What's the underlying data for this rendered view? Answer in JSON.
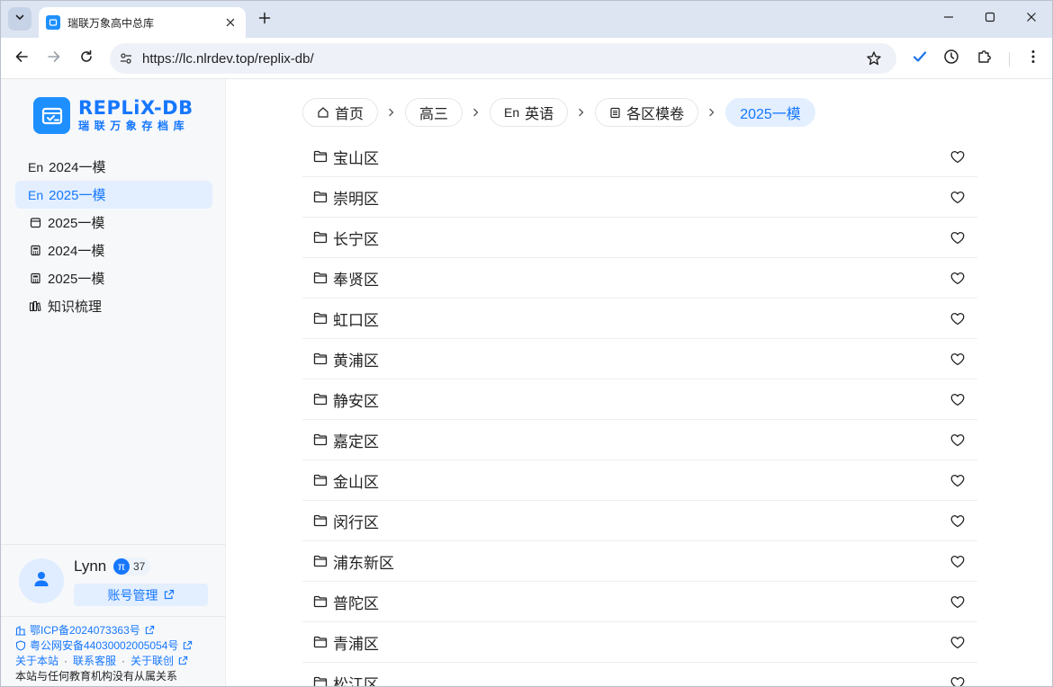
{
  "browser": {
    "tab_title": "瑞联万象高中总库",
    "url": "https://lc.nlrdev.top/replix-db/"
  },
  "logo": {
    "title": "REPLiX-DB",
    "subtitle": "瑞联万象存档库"
  },
  "sidebar": {
    "items": [
      {
        "icon": "En",
        "label": "2024一模",
        "active": false
      },
      {
        "icon": "En",
        "label": "2025一模",
        "active": true
      },
      {
        "icon": "calendar-icon",
        "label": "2025一模",
        "active": false
      },
      {
        "icon": "calculator-icon",
        "label": "2024一模",
        "active": false
      },
      {
        "icon": "calculator-icon",
        "label": "2025一模",
        "active": false
      },
      {
        "icon": "books-icon",
        "label": "知识梳理",
        "active": false
      }
    ]
  },
  "user": {
    "name": "Lynn",
    "badge_symbol": "π",
    "points": "37",
    "account_label": "账号管理"
  },
  "footer": {
    "icp": "鄂ICP备2024073363号",
    "police": "粤公网安备44030002005054号",
    "about": "关于本站",
    "contact": "联系客服",
    "about_lianchuang": "关于联创",
    "disclaimer": "本站与任何教育机构没有从属关系"
  },
  "breadcrumb": {
    "home": "首页",
    "grade": "高三",
    "subject_prefix": "En",
    "subject": "英语",
    "category": "各区模卷",
    "current": "2025一模"
  },
  "districts": [
    "宝山区",
    "崇明区",
    "长宁区",
    "奉贤区",
    "虹口区",
    "黄浦区",
    "静安区",
    "嘉定区",
    "金山区",
    "闵行区",
    "浦东新区",
    "普陀区",
    "青浦区",
    "松江区"
  ],
  "colors": {
    "accent": "#1677ff",
    "active_bg": "#e3efff",
    "titlebar": "#dde5f3"
  }
}
